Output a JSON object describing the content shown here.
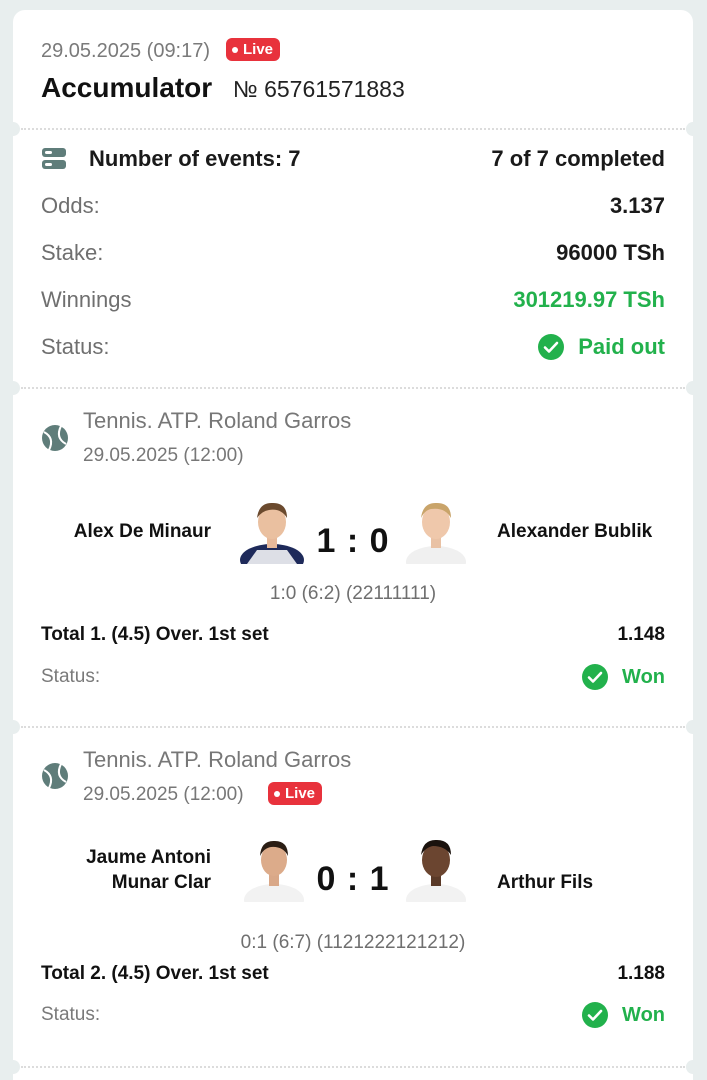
{
  "header": {
    "date": "29.05.2025 (09:17)",
    "live": "Live",
    "title": "Accumulator",
    "number": "№ 65761571883"
  },
  "summary": {
    "events_label": "Number of events: 7",
    "completed": "7 of 7 completed",
    "odds_label": "Odds:",
    "odds_value": "3.137",
    "stake_label": "Stake:",
    "stake_value": "96000 TSh",
    "winnings_label": "Winnings",
    "winnings_value": "301219.97 TSh",
    "status_label": "Status:",
    "status_value": "Paid out"
  },
  "events": [
    {
      "league": "Tennis. ATP. Roland Garros",
      "date": "29.05.2025 (12:00)",
      "team1": "Alex De Minaur",
      "team2": "Alexander Bublik",
      "score": "1 : 0",
      "sub_score": "1:0 (6:2) (22111111)",
      "bet": "Total 1. (4.5) Over. 1st set",
      "odds": "1.148",
      "status_label": "Status:",
      "status": "Won"
    },
    {
      "league": "Tennis. ATP. Roland Garros",
      "date": "29.05.2025 (12:00)",
      "live": "Live",
      "team1_line1": "Jaume Antoni",
      "team1_line2": "Munar Clar",
      "team2": "Arthur Fils",
      "score": "0 : 1",
      "sub_score": "0:1 (6:7) (1121222121212)",
      "bet": "Total 2. (4.5) Over. 1st set",
      "odds": "1.188",
      "status_label": "Status:",
      "status": "Won"
    }
  ],
  "colors": {
    "green": "#22b14c",
    "live_red": "#e8323c",
    "icon_grey": "#5f7d7a"
  }
}
